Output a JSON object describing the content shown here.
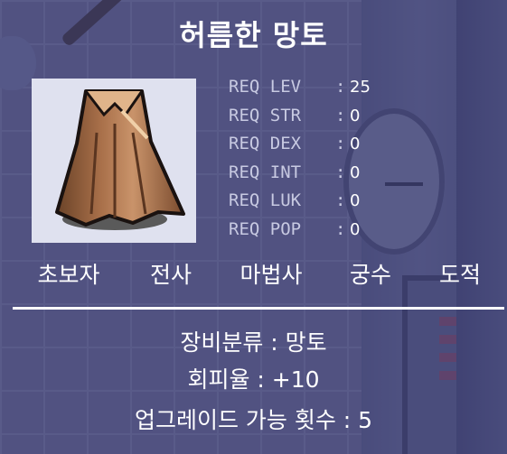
{
  "item": {
    "name": "허름한 망토",
    "icon": "cape-icon",
    "requirements": [
      {
        "label": "REQ LEV",
        "value": "25"
      },
      {
        "label": "REQ STR",
        "value": "0"
      },
      {
        "label": "REQ DEX",
        "value": "0"
      },
      {
        "label": "REQ INT",
        "value": "0"
      },
      {
        "label": "REQ LUK",
        "value": "0"
      },
      {
        "label": "REQ POP",
        "value": "0"
      }
    ],
    "separator": ":",
    "jobs": [
      "초보자",
      "전사",
      "마법사",
      "궁수",
      "도적"
    ],
    "info": [
      "장비분류 : 망토",
      "회피율 : +10",
      "업그레이드 가능 횟수 : 5"
    ]
  },
  "colors": {
    "title": "#ffffff",
    "req_label": "#c8cae2",
    "icon_bg": "#dfe1ef",
    "overlay": "#3c3e6e"
  }
}
